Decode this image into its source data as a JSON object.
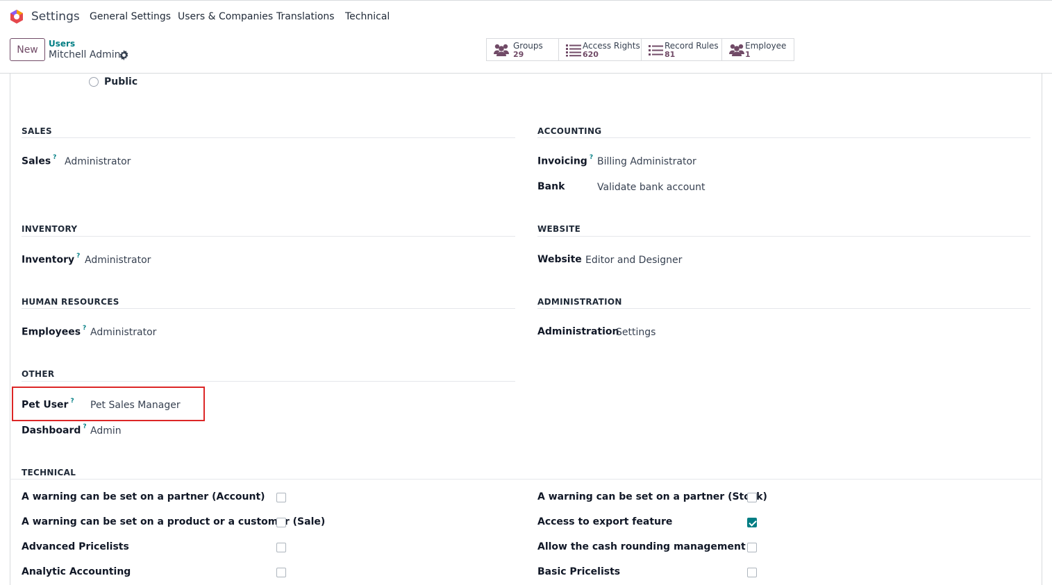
{
  "app": {
    "title": "Settings"
  },
  "menu": [
    "General Settings",
    "Users & Companies",
    "Translations",
    "Technical"
  ],
  "control_panel": {
    "new_label": "New",
    "breadcrumb_parent": "Users",
    "breadcrumb_current": "Mitchell Admin"
  },
  "stat_buttons": [
    {
      "label": "Groups",
      "value": "29",
      "icon": "users-icon"
    },
    {
      "label": "Access Rights",
      "value": "620",
      "icon": "list-icon"
    },
    {
      "label": "Record Rules",
      "value": "81",
      "icon": "list-icon"
    },
    {
      "label": "Employee",
      "value": "1",
      "icon": "users-icon"
    }
  ],
  "user_type_option": "Public",
  "sections": {
    "sales": {
      "title": "SALES",
      "fields": [
        {
          "label": "Sales",
          "value": "Administrator"
        }
      ]
    },
    "accounting": {
      "title": "ACCOUNTING",
      "fields": [
        {
          "label": "Invoicing",
          "value": "Billing Administrator"
        },
        {
          "label": "Bank",
          "value": "Validate bank account"
        }
      ]
    },
    "inventory": {
      "title": "INVENTORY",
      "fields": [
        {
          "label": "Inventory",
          "value": "Administrator"
        }
      ]
    },
    "website": {
      "title": "WEBSITE",
      "fields": [
        {
          "label": "Website",
          "value": "Editor and Designer"
        }
      ]
    },
    "human_resources": {
      "title": "HUMAN RESOURCES",
      "fields": [
        {
          "label": "Employees",
          "value": "Administrator"
        }
      ]
    },
    "administration": {
      "title": "ADMINISTRATION",
      "fields": [
        {
          "label": "Administration",
          "value": "Settings"
        }
      ]
    },
    "other": {
      "title": "OTHER",
      "fields": [
        {
          "label": "Pet User",
          "value": "Pet Sales Manager"
        },
        {
          "label": "Dashboard",
          "value": "Admin"
        }
      ]
    },
    "technical": {
      "title": "TECHNICAL",
      "left": [
        {
          "label": "A warning can be set on a partner (Account)",
          "checked": false
        },
        {
          "label": "A warning can be set on a product or a customer (Sale)",
          "checked": false
        },
        {
          "label": "Advanced Pricelists",
          "checked": false
        },
        {
          "label": "Analytic Accounting",
          "checked": false
        }
      ],
      "right": [
        {
          "label": "A warning can be set on a partner (Stock)",
          "checked": false
        },
        {
          "label": "Access to export feature",
          "checked": true
        },
        {
          "label": "Allow the cash rounding management",
          "checked": false
        },
        {
          "label": "Basic Pricelists",
          "checked": false
        }
      ]
    }
  },
  "colors": {
    "brand": "#714b67",
    "accent": "#017e84",
    "highlight": "#dc2626"
  }
}
